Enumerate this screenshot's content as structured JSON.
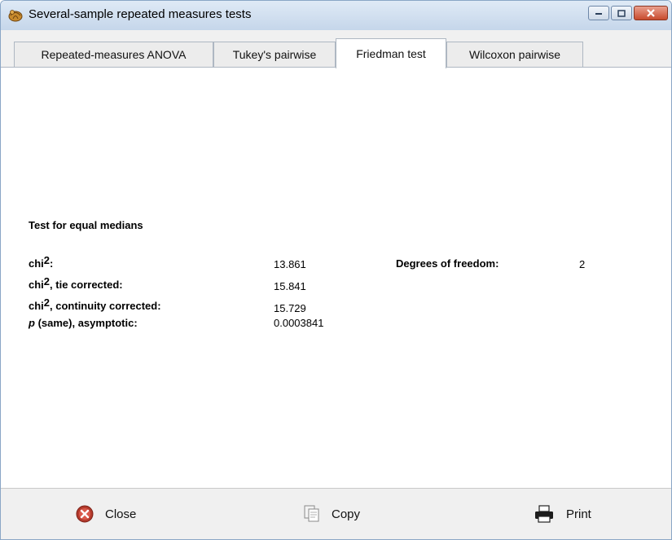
{
  "window": {
    "title": "Several-sample repeated measures tests"
  },
  "tabs": [
    {
      "label": "Repeated-measures ANOVA",
      "active": false
    },
    {
      "label": "Tukey's pairwise",
      "active": false
    },
    {
      "label": "Friedman test",
      "active": true
    },
    {
      "label": "Wilcoxon pairwise",
      "active": false
    }
  ],
  "results": {
    "heading": "Test for equal medians",
    "rows": [
      {
        "label_pre": "chi",
        "label_sup": "2",
        "label_post": ":",
        "value": "13.861"
      },
      {
        "label_pre": "chi",
        "label_sup": "2",
        "label_post": ", tie corrected:",
        "value": "15.841"
      },
      {
        "label_pre": "chi",
        "label_sup": "2",
        "label_post": ", continuity corrected:",
        "value": "15.729"
      },
      {
        "label_pre": "p",
        "label_sup": "",
        "label_post": " (same), asymptotic:",
        "value": "0.0003841"
      }
    ],
    "dof_label": "Degrees of freedom:",
    "dof_value": "2"
  },
  "footer": {
    "close_label": "Close",
    "copy_label": "Copy",
    "print_label": "Print"
  },
  "icons": {
    "app": "app-shell-icon",
    "close": "close-icon",
    "copy": "copy-icon",
    "print": "printer-icon"
  },
  "colors": {
    "titlebar": "#c5d6ea",
    "close_button": "#c84b2e",
    "close_icon": "#c0392b"
  }
}
